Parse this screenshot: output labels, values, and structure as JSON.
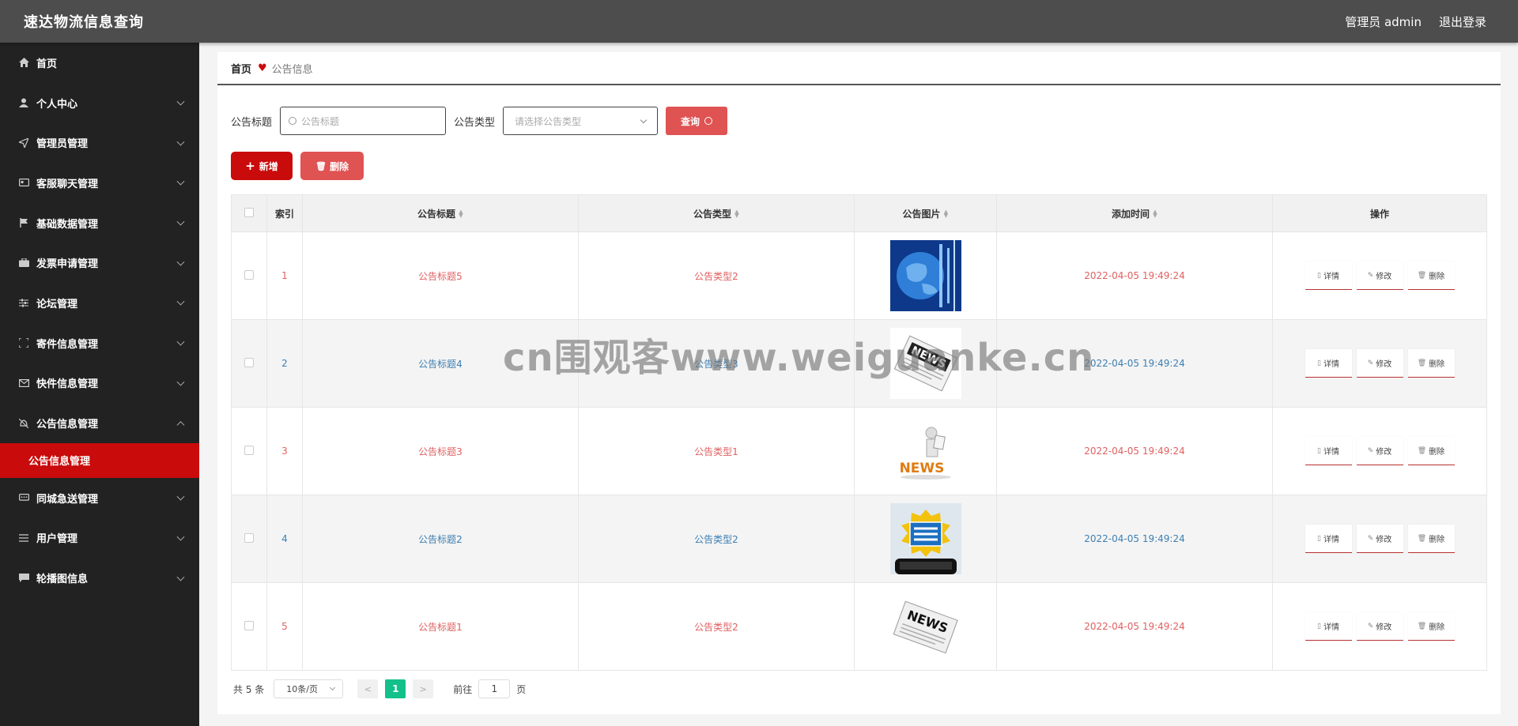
{
  "app": {
    "title": "速达物流信息查询",
    "user_label": "管理员 admin",
    "logout_label": "退出登录"
  },
  "sidebar": {
    "items": [
      {
        "label": "首页",
        "icon": "home-icon",
        "expandable": false
      },
      {
        "label": "个人中心",
        "icon": "user-icon",
        "expandable": true
      },
      {
        "label": "管理员管理",
        "icon": "send-icon",
        "expandable": true
      },
      {
        "label": "客服聊天管理",
        "icon": "card-icon",
        "expandable": true
      },
      {
        "label": "基础数据管理",
        "icon": "flag-icon",
        "expandable": true
      },
      {
        "label": "发票申请管理",
        "icon": "briefcase-icon",
        "expandable": true
      },
      {
        "label": "论坛管理",
        "icon": "sliders-icon",
        "expandable": true
      },
      {
        "label": "寄件信息管理",
        "icon": "scan-icon",
        "expandable": true
      },
      {
        "label": "快件信息管理",
        "icon": "mail-icon",
        "expandable": true
      },
      {
        "label": "公告信息管理",
        "icon": "bell-off-icon",
        "expandable": true,
        "expanded": true
      },
      {
        "label": "同城急送管理",
        "icon": "chat-icon",
        "expandable": true
      },
      {
        "label": "用户管理",
        "icon": "list-icon",
        "expandable": true
      },
      {
        "label": "轮播图信息",
        "icon": "message-icon",
        "expandable": true
      }
    ],
    "active_sub": "公告信息管理"
  },
  "breadcrumb": {
    "home": "首页",
    "current": "公告信息"
  },
  "search": {
    "title_label": "公告标题",
    "title_placeholder": "公告标题",
    "type_label": "公告类型",
    "type_placeholder": "请选择公告类型",
    "query_label": "查询"
  },
  "actions": {
    "add_label": "新增",
    "delete_label": "删除"
  },
  "table": {
    "headers": {
      "index": "索引",
      "title": "公告标题",
      "type": "公告类型",
      "image": "公告图片",
      "time": "添加时间",
      "ops": "操作"
    },
    "rows": [
      {
        "index": "1",
        "title": "公告标题5",
        "type": "公告类型2",
        "image": "globe-news-image",
        "time": "2022-04-05 19:49:24"
      },
      {
        "index": "2",
        "title": "公告标题4",
        "type": "公告类型3",
        "image": "newspaper-image",
        "time": "2022-04-05 19:49:24"
      },
      {
        "index": "3",
        "title": "公告标题3",
        "type": "公告类型1",
        "image": "news-figure-image",
        "time": "2022-04-05 19:49:24"
      },
      {
        "index": "4",
        "title": "公告标题2",
        "type": "公告类型2",
        "image": "breaking-news-image",
        "time": "2022-04-05 19:49:24"
      },
      {
        "index": "5",
        "title": "公告标题1",
        "type": "公告类型2",
        "image": "newspaper-image",
        "time": "2022-04-05 19:49:24"
      }
    ],
    "op_labels": {
      "detail": "详情",
      "edit": "修改",
      "delete": "删除"
    }
  },
  "pagination": {
    "total_text": "共 5 条",
    "page_size": "10条/页",
    "current_page": "1",
    "goto_prefix": "前往",
    "goto_value": "1",
    "goto_suffix": "页"
  },
  "watermark": "cn围观客www.weiguanke.cn",
  "colors": {
    "topbar": "#4d4d4d",
    "sidebar": "#222222",
    "accent": "#c90b0b",
    "button_light": "#e05353",
    "row_red": "#e06060",
    "row_blue": "#3d7fb2",
    "pager_active": "#13c08a"
  }
}
